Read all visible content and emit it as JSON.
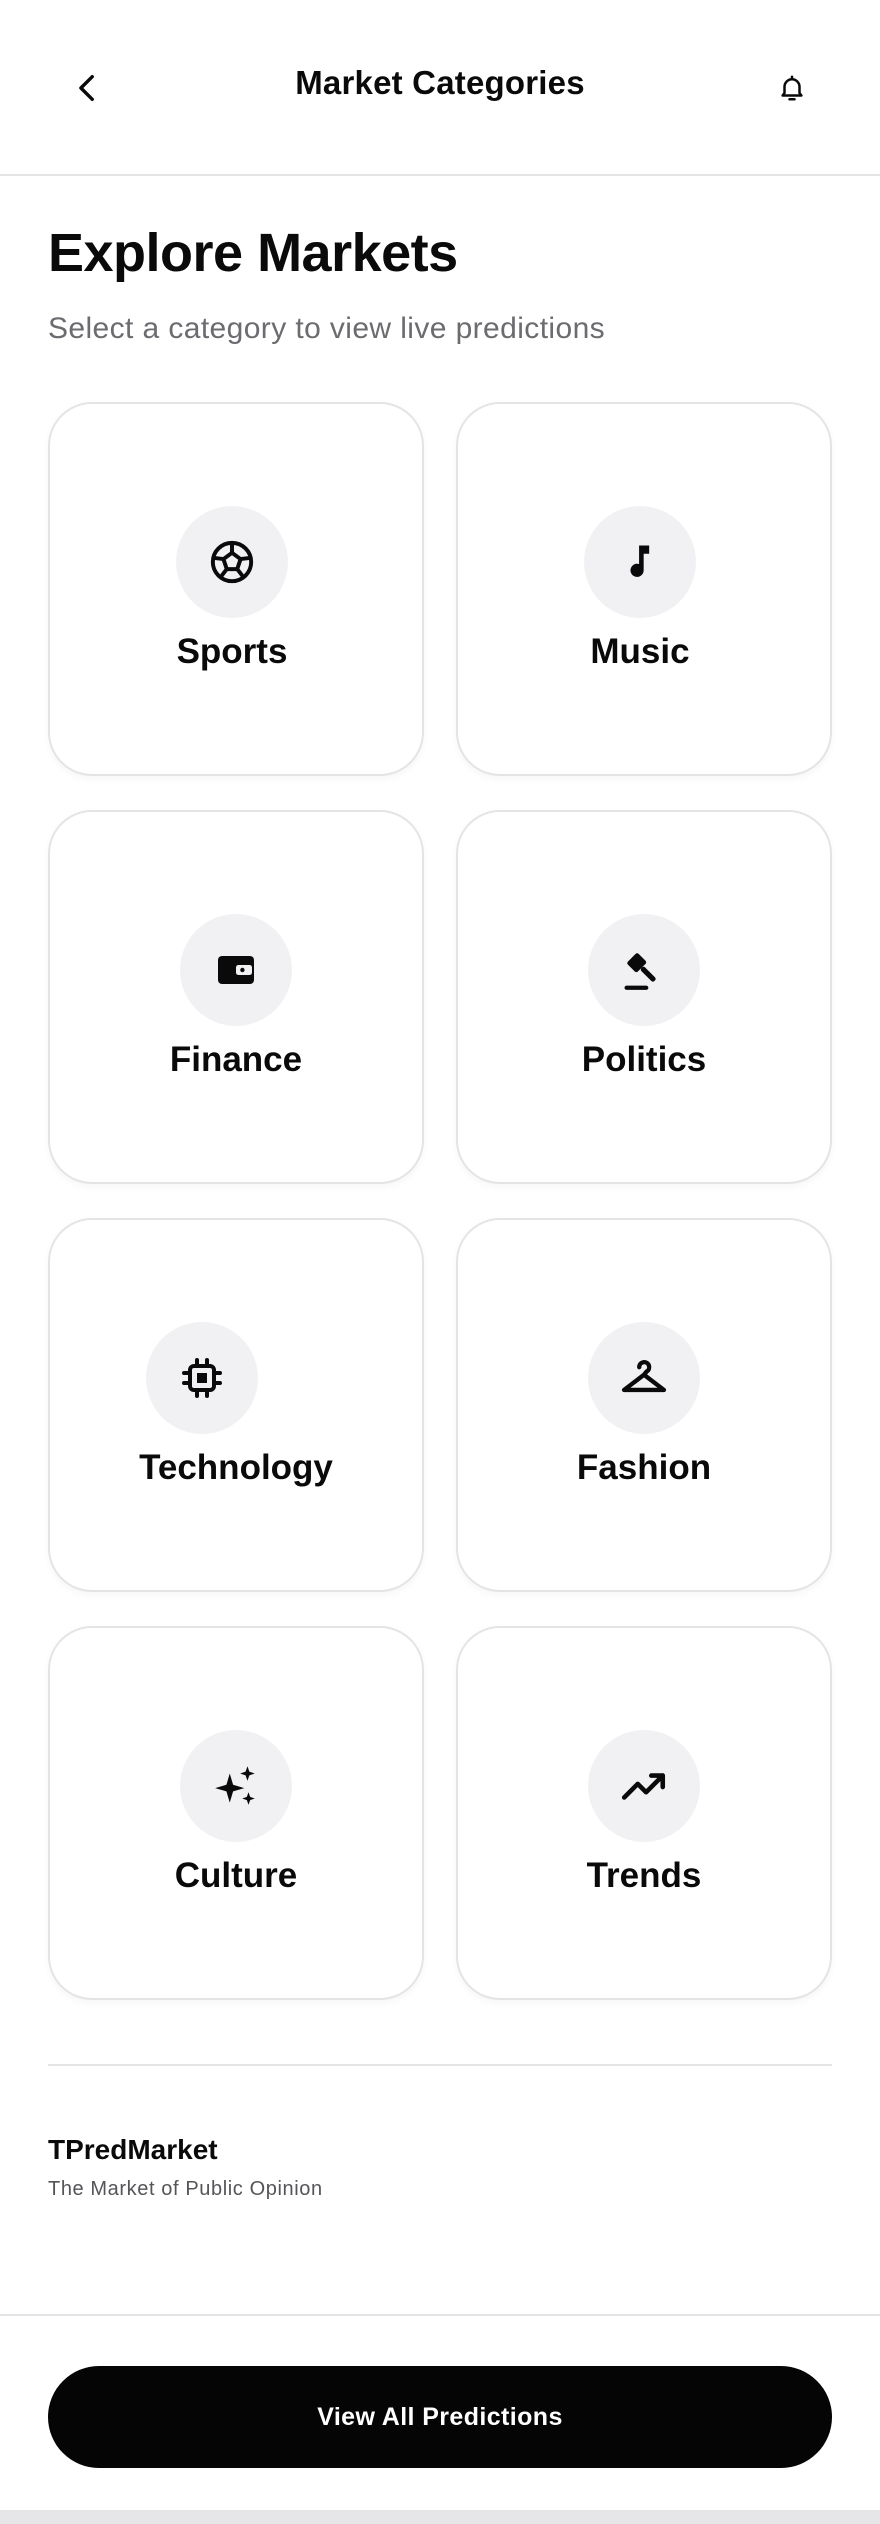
{
  "header": {
    "title": "Market Categories",
    "back_icon": "chevron-left-icon",
    "notification_icon": "bell-icon"
  },
  "intro": {
    "heading": "Explore Markets",
    "subheading": "Select a category to view live predictions"
  },
  "categories": [
    {
      "label": "Sports",
      "icon": "soccer-ball-icon"
    },
    {
      "label": "Music",
      "icon": "music-note-icon"
    },
    {
      "label": "Finance",
      "icon": "wallet-icon"
    },
    {
      "label": "Politics",
      "icon": "gavel-icon"
    },
    {
      "label": "Technology",
      "icon": "cpu-chip-icon"
    },
    {
      "label": "Fashion",
      "icon": "hanger-icon"
    },
    {
      "label": "Culture",
      "icon": "sparkles-icon"
    },
    {
      "label": "Trends",
      "icon": "trending-up-icon"
    }
  ],
  "footer": {
    "brand": "TPredMarket",
    "tagline": "The Market of Public Opinion"
  },
  "cta": {
    "label": "View All Predictions"
  },
  "colors": {
    "primary": "#050505",
    "icon_bg": "#f1f1f4",
    "border": "#e4e4e7",
    "muted_text": "#6b6b70"
  }
}
